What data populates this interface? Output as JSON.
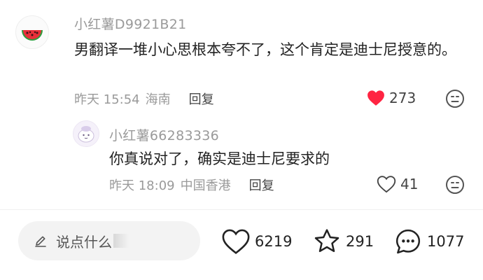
{
  "comments": [
    {
      "username": "小红薯D9921B21",
      "avatar": "watermelon-icon",
      "text": "男翻译一堆小心思根本夸不了，这个肯定是迪士尼授意的。",
      "time": "昨天 15:54",
      "location": "海南",
      "reply_label": "回复",
      "likes": "273",
      "liked": true,
      "like_color": "#ff2442",
      "replies": [
        {
          "username": "小红薯66283336",
          "avatar": "cartoon-avatar",
          "text": "你真说对了，确实是迪士尼要求的",
          "time": "昨天 18:09",
          "location": "中国香港",
          "reply_label": "回复",
          "likes": "41",
          "liked": false
        }
      ]
    }
  ],
  "bottom_bar": {
    "input_placeholder": "说点什么",
    "likes": "6219",
    "stars": "291",
    "comments": "1077"
  }
}
